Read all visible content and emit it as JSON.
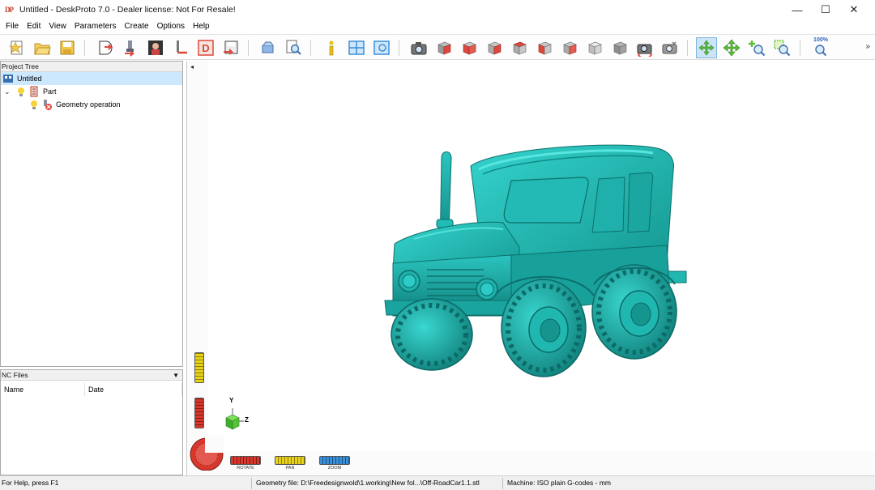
{
  "window": {
    "app_icon_text": "DP",
    "title": "Untitled - DeskProto 7.0 - Dealer license: Not For Resale!",
    "minimize_glyph": "—",
    "maximize_glyph": "☐",
    "close_glyph": "✕"
  },
  "menu": {
    "items": [
      "File",
      "Edit",
      "View",
      "Parameters",
      "Create",
      "Options",
      "Help"
    ]
  },
  "toolbar": {
    "zoom_level_label": "100%",
    "overflow_glyph": "»",
    "icons": [
      "new-project-icon",
      "open-project-icon",
      "save-project-icon",
      "import-geometry-icon",
      "add-operation-icon",
      "bitmap-icon",
      "toolpath-icon",
      "calculate-icon",
      "save-nc-icon",
      "simulate-icon",
      "preview-icon",
      "info-icon",
      "layout-icon",
      "view-settings-icon",
      "camera-icon",
      "view-iso-icon",
      "view-front-icon",
      "view-right-icon",
      "view-back-icon",
      "view-left-icon",
      "view-top-icon",
      "view-bottom-icon",
      "view-shaded-icon",
      "rotate-view-icon",
      "reset-view-icon",
      "rotate-mode-icon",
      "pan-mode-icon",
      "zoom-in-icon",
      "zoom-window-icon",
      "zoom-fit-icon"
    ],
    "colors": {
      "accent_red": "#e0473c",
      "accent_yellow": "#f2c94c",
      "accent_blue": "#3b8fd8",
      "accent_green": "#5bbf3a"
    }
  },
  "project_tree": {
    "header": "Project Tree",
    "items": [
      {
        "label": "Untitled",
        "icon": "project-icon"
      },
      {
        "label": "Part",
        "icon": "part-icon",
        "expander": "⌄"
      },
      {
        "label": "Geometry operation",
        "icon": "geometry-operation-icon"
      }
    ]
  },
  "nc_files": {
    "header": "NC Files",
    "dropdown_glyph": "▼",
    "columns": [
      "Name",
      "Date"
    ]
  },
  "viewport": {
    "collapse_glyph": "◂",
    "model_color": "#1fb5b1",
    "wheels": [
      {
        "label": "ROTATE",
        "color": "#d9372b"
      },
      {
        "label": "PAN",
        "color": "#e8d21b"
      },
      {
        "label": "ZOOM",
        "color": "#3b8fd8"
      }
    ],
    "axes": {
      "y_label": "Y",
      "z_label": "Z"
    }
  },
  "status": {
    "help": "For Help, press F1",
    "geometry_file": "Geometry file: D:\\Freedesignwold\\1.working\\New fol...\\Off-RoadCar1.1.stl",
    "machine": "Machine: ISO plain G-codes - mm"
  }
}
